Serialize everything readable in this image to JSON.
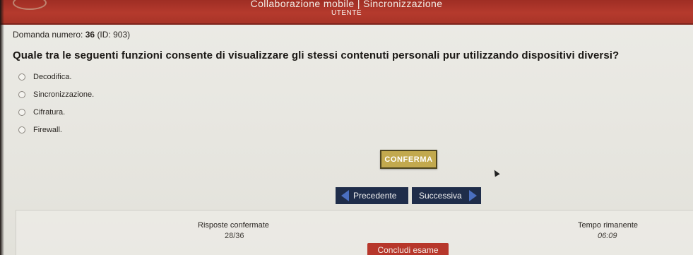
{
  "header": {
    "title": "Collaborazione mobile | Sincronizzazione",
    "user_label": "UTENTE"
  },
  "question": {
    "number_label": "Domanda numero:",
    "number": "36",
    "id_text": "(ID: 903)",
    "text": "Quale tra le seguenti funzioni consente di visualizzare gli stessi contenuti personali pur utilizzando dispositivi diversi?",
    "options": [
      {
        "label": "Decodifica."
      },
      {
        "label": "Sincronizzazione."
      },
      {
        "label": "Cifratura."
      },
      {
        "label": "Firewall."
      }
    ]
  },
  "actions": {
    "confirm_label": "Conferma",
    "prev_label": "Precedente",
    "next_label": "Successiva",
    "end_exam_label": "Concludi esame"
  },
  "status": {
    "answered_label": "Risposte confermate",
    "answered_value": "28/36",
    "time_label": "Tempo rimanente",
    "time_value": "06:09"
  },
  "colors": {
    "header_red": "#b53a2d",
    "confirm_gold": "#c2a94e",
    "nav_navy": "#1f2d4a",
    "arrow_blue": "#4a6fc0"
  }
}
